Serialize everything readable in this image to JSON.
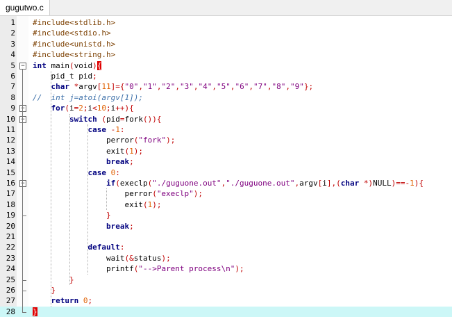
{
  "tab": {
    "title": "gugutwo.c"
  },
  "lines": [
    {
      "n": "1",
      "code": "#include<stdlib.h>"
    },
    {
      "n": "2",
      "code": "#include<stdio.h>"
    },
    {
      "n": "3",
      "code": "#include<unistd.h>"
    },
    {
      "n": "4",
      "code": "#include<string.h>"
    },
    {
      "n": "5",
      "code": "int main(void){"
    },
    {
      "n": "6",
      "code": "    pid_t pid;"
    },
    {
      "n": "7",
      "code": "    char *argv[11]={\"0\",\"1\",\"2\",\"3\",\"4\",\"5\",\"6\",\"7\",\"8\",\"9\"};"
    },
    {
      "n": "8",
      "code": "//  int j=atoi(argv[1]);"
    },
    {
      "n": "9",
      "code": "    for(i=2;i<10;i++){"
    },
    {
      "n": "10",
      "code": "        switch (pid=fork()){"
    },
    {
      "n": "11",
      "code": "            case -1:"
    },
    {
      "n": "12",
      "code": "                perror(\"fork\");"
    },
    {
      "n": "13",
      "code": "                exit(1);"
    },
    {
      "n": "14",
      "code": "                break;"
    },
    {
      "n": "15",
      "code": "            case 0:"
    },
    {
      "n": "16",
      "code": "                if(execlp(\"./guguone.out\",\"./guguone.out\",argv[i],(char *)NULL)==-1){"
    },
    {
      "n": "17",
      "code": "                    perror(\"execlp\");"
    },
    {
      "n": "18",
      "code": "                    exit(1);"
    },
    {
      "n": "19",
      "code": "                }"
    },
    {
      "n": "20",
      "code": "                break;"
    },
    {
      "n": "21",
      "code": ""
    },
    {
      "n": "22",
      "code": "            default:"
    },
    {
      "n": "23",
      "code": "                wait(&status);"
    },
    {
      "n": "24",
      "code": "                printf(\"-->Parent process\\n\");"
    },
    {
      "n": "25",
      "code": "        }"
    },
    {
      "n": "26",
      "code": "    }"
    },
    {
      "n": "27",
      "code": "    return 0;"
    },
    {
      "n": "28",
      "code": "}"
    }
  ],
  "current_line": 28,
  "colors": {
    "current_line": "#ccf7f7",
    "brace_match": "#e00000",
    "keyword": "#00007f",
    "string": "#7f007f",
    "number": "#e06000",
    "comment": "#3a6ea8",
    "preprocessor": "#7b3f00"
  }
}
